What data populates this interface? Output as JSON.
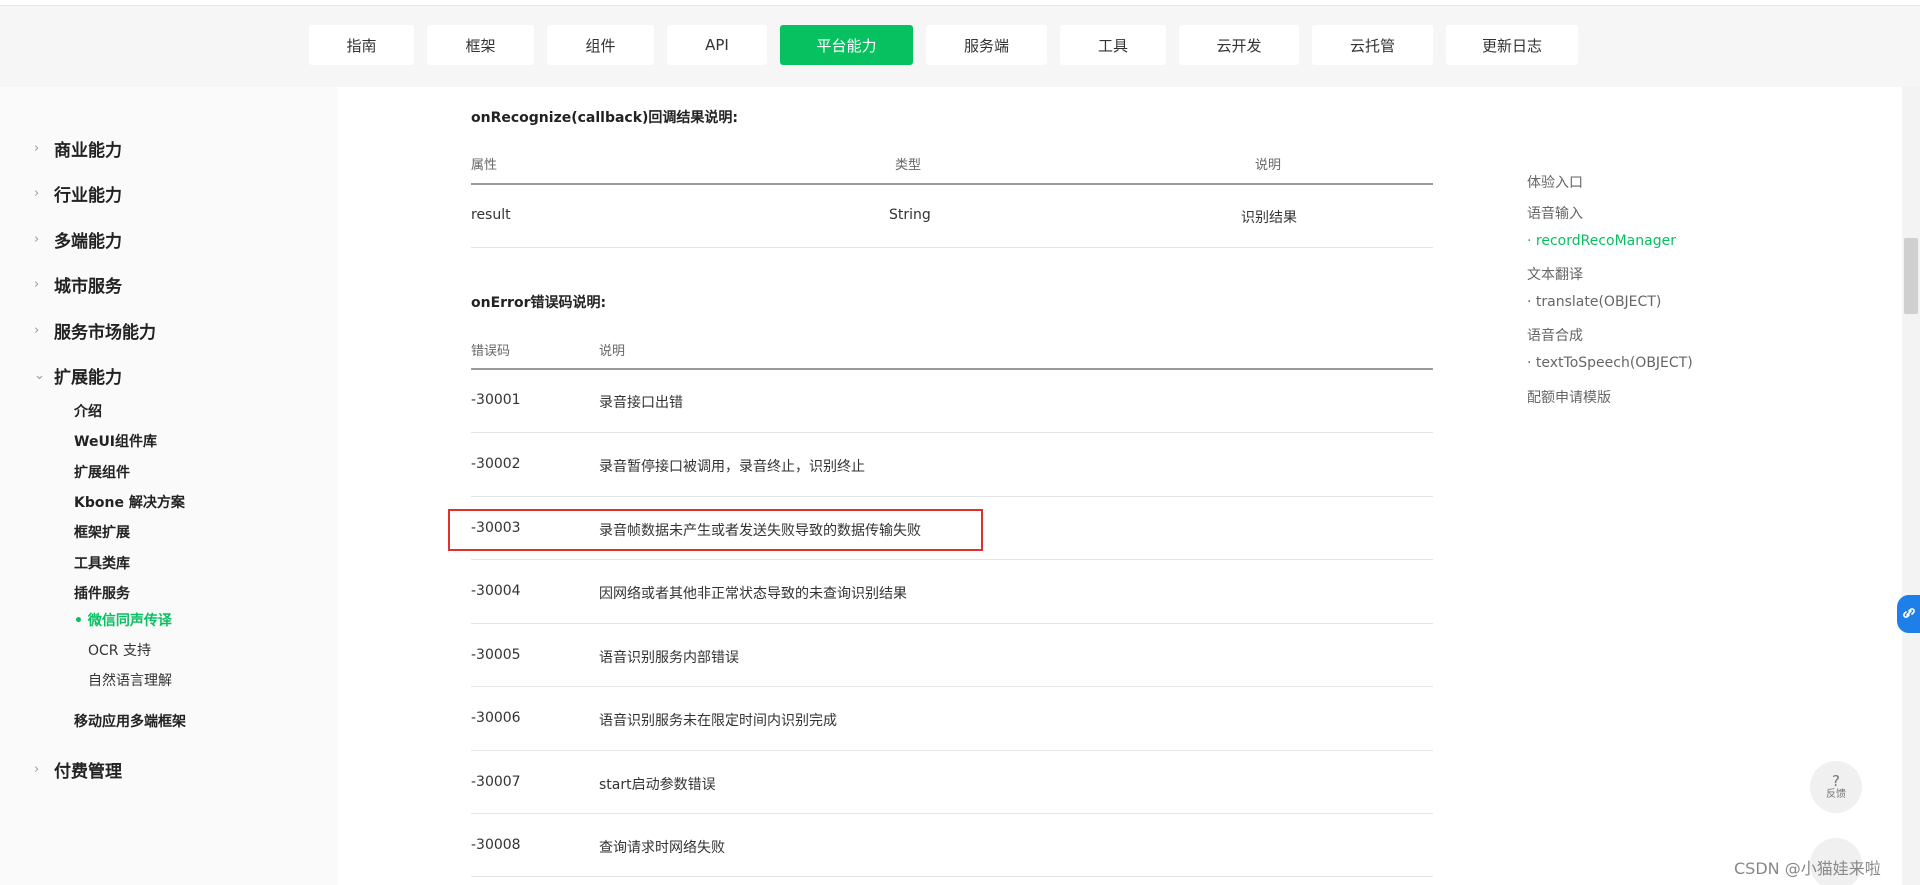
{
  "topnav": {
    "tabs": [
      {
        "label": "指南",
        "active": false
      },
      {
        "label": "框架",
        "active": false
      },
      {
        "label": "组件",
        "active": false
      },
      {
        "label": "API",
        "active": false
      },
      {
        "label": "平台能力",
        "active": true
      },
      {
        "label": "服务端",
        "active": false
      },
      {
        "label": "工具",
        "active": false
      },
      {
        "label": "云开发",
        "active": false
      },
      {
        "label": "云托管",
        "active": false
      },
      {
        "label": "更新日志",
        "active": false
      }
    ]
  },
  "sidebar": {
    "categories": [
      {
        "label": "商业能力",
        "chevron": "›"
      },
      {
        "label": "行业能力",
        "chevron": "›"
      },
      {
        "label": "多端能力",
        "chevron": "›"
      },
      {
        "label": "城市服务",
        "chevron": "›"
      },
      {
        "label": "服务市场能力",
        "chevron": "›"
      },
      {
        "label": "扩展能力",
        "chevron": "⌄"
      },
      {
        "label": "付费管理",
        "chevron": "›"
      }
    ],
    "ext_items": [
      "介绍",
      "WeUI组件库",
      "扩展组件",
      "Kbone 解决方案",
      "框架扩展",
      "工具类库",
      "插件服务"
    ],
    "active_item": "微信同声传译",
    "active_bullet": "•",
    "sub_items": [
      "OCR 支持",
      "自然语言理解"
    ],
    "mobile_item": "移动应用多端框架"
  },
  "content": {
    "recognize_title": "onRecognize(callback)回调结果说明:",
    "recognize_headers": [
      "属性",
      "类型",
      "说明"
    ],
    "recognize_rows": [
      [
        "result",
        "String",
        "识别结果"
      ]
    ],
    "error_title": "onError错误码说明:",
    "error_headers": [
      "错误码",
      "说明"
    ],
    "error_rows": [
      [
        "-30001",
        "录音接口出错"
      ],
      [
        "-30002",
        "录音暂停接口被调用，录音终止，识别终止"
      ],
      [
        "-30003",
        "录音帧数据未产生或者发送失败导致的数据传输失败"
      ],
      [
        "-30004",
        "因网络或者其他非正常状态导致的未查询识别结果"
      ],
      [
        "-30005",
        "语音识别服务内部错误"
      ],
      [
        "-30006",
        "语音识别服务未在限定时间内识别完成"
      ],
      [
        "-30007",
        "start启动参数错误"
      ],
      [
        "-30008",
        "查询请求时网络失败"
      ]
    ]
  },
  "toc": {
    "items": [
      {
        "label": "体验入口",
        "active": false
      },
      {
        "label": "语音输入",
        "active": false
      },
      {
        "label": "· recordRecoManager",
        "active": true
      },
      {
        "label": "文本翻译",
        "active": false
      },
      {
        "label": "· translate(OBJECT)",
        "active": false
      },
      {
        "label": "语音合成",
        "active": false
      },
      {
        "label": "· textToSpeech(OBJECT)",
        "active": false
      },
      {
        "label": "配额申请模版",
        "active": false
      }
    ]
  },
  "feedback": {
    "icon": "?",
    "label": "反馈"
  },
  "watermark": "CSDN @小猫娃来啦",
  "colors": {
    "accent": "#07c160",
    "highlight_border": "#e03030",
    "float_button": "#1e7fe8"
  }
}
